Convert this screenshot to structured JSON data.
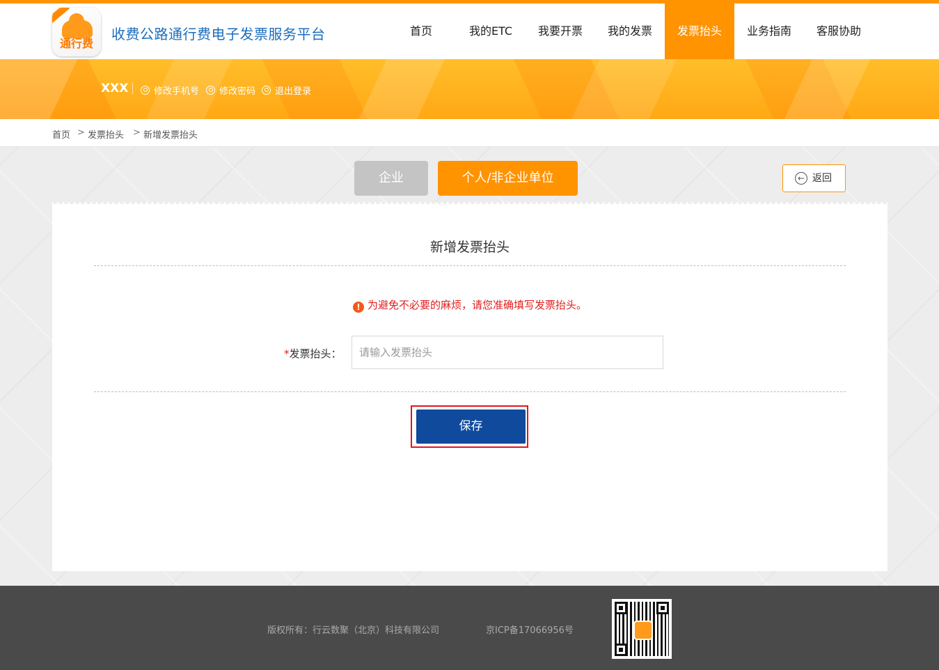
{
  "header": {
    "logo_text": "通行费",
    "site_title": "收费公路通行费电子发票服务平台",
    "nav": [
      {
        "label": "首页"
      },
      {
        "label": "我的ETC"
      },
      {
        "label": "我要开票"
      },
      {
        "label": "我的发票"
      },
      {
        "label": "发票抬头",
        "active": true
      },
      {
        "label": "业务指南"
      },
      {
        "label": "客服协助"
      }
    ]
  },
  "banner": {
    "username": "XXX",
    "links": [
      "修改手机号",
      "修改密码",
      "退出登录"
    ]
  },
  "breadcrumb": [
    "首页",
    "发票抬头",
    "新增发票抬头"
  ],
  "breadcrumb_separator": ">",
  "tabs": {
    "enterprise": "企业",
    "personal": "个人/非企业单位"
  },
  "back_label": "返回",
  "form": {
    "title": "新增发票抬头",
    "warning_icon": "!",
    "warning": "为避免不必要的麻烦，请您准确填写发票抬头。",
    "required_mark": "*",
    "field_label": "发票抬头：",
    "field_value": "",
    "field_placeholder": "请输入发票抬头",
    "save_label": "保存"
  },
  "footer": {
    "copyright": "版权所有：行云数聚（北京）科技有限公司",
    "icp": "京ICP备17066956号"
  },
  "colors": {
    "accent": "#ff9300",
    "primary_button": "#0f4a9c",
    "title_blue": "#1a6dbd",
    "warning_red": "#e02020"
  }
}
